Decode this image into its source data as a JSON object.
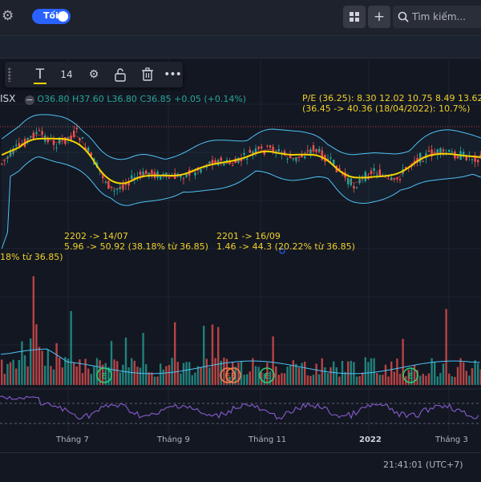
{
  "toolbar": {
    "theme_toggle_label": "Tối",
    "search_placeholder": "Tìm kiếm..."
  },
  "drawing_toolbar": {
    "font_size": "14"
  },
  "legend": {
    "symbol": "ISX",
    "open": "O36.80",
    "high": "H37.60",
    "low": "L36.80",
    "close": "C36.85",
    "change": "+0.05 (+0.14%)"
  },
  "annotations": {
    "pe_line1": "P/E (36.25): 8.30 12.02 10.75 8.49 13.62",
    "pe_line2": "(36.45 -> 40.36 (18/04/2022): 10.7%)",
    "left_partial": "18% từ 36.85)",
    "a2202_line1": "2202 -> 14/07",
    "a2202_line2": "5.96 -> 50.92 (38.18% từ 36.85)",
    "a2201_line1": "2201 -> 16/09",
    "a2201_line2": "1.46 -> 44.3 (20.22% từ 36.85)"
  },
  "x_axis": {
    "labels": [
      "Tháng 7",
      "Tháng 9",
      "Tháng 11",
      "2022",
      "Tháng 3"
    ]
  },
  "markers": {
    "labels": [
      "E",
      "E",
      "E",
      "E",
      "E"
    ]
  },
  "status": {
    "clock": "21:41:01 (UTC+7)"
  },
  "colors": {
    "background": "#131722",
    "up": "#26a69a",
    "down": "#ef5350",
    "bands": "#4fc3f7",
    "ma": "#f5d300",
    "rsi": "#7e57c2",
    "annotation": "#f0d02b",
    "accent": "#2962ff"
  }
}
